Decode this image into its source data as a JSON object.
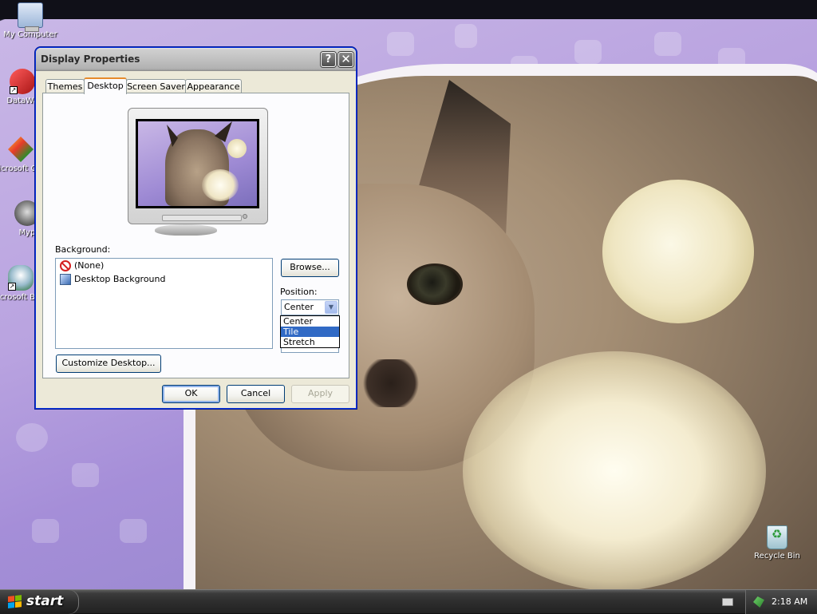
{
  "desktop": {
    "icons": [
      {
        "label": "My Computer"
      },
      {
        "label": "DataWa"
      },
      {
        "label": "Microsoft C++"
      },
      {
        "label": "Myp"
      },
      {
        "label": "Microsoft Basic"
      },
      {
        "label": "Recycle Bin"
      }
    ]
  },
  "window": {
    "title": "Display Properties",
    "help_label": "?",
    "close_label": "✕",
    "tabs": [
      {
        "label": "Themes"
      },
      {
        "label": "Desktop"
      },
      {
        "label": "Screen Saver"
      },
      {
        "label": "Appearance"
      }
    ],
    "active_tab": "Desktop",
    "background_label": "Background:",
    "background_items": [
      {
        "label": "(None)",
        "icon": "none-icon"
      },
      {
        "label": "Desktop Background",
        "icon": "image-icon"
      }
    ],
    "browse_label": "Browse...",
    "position_label": "Position:",
    "position_value": "Center",
    "position_options": [
      {
        "label": "Center"
      },
      {
        "label": "Tile"
      },
      {
        "label": "Stretch"
      }
    ],
    "highlighted_option": "Tile",
    "customize_label": "Customize Desktop...",
    "ok_label": "OK",
    "cancel_label": "Cancel",
    "apply_label": "Apply"
  },
  "taskbar": {
    "start_label": "start",
    "clock": "2:18 AM"
  },
  "colors": {
    "accent": "#316ac5",
    "tab_highlight": "#e68b2c",
    "window_border": "#0831d9"
  }
}
